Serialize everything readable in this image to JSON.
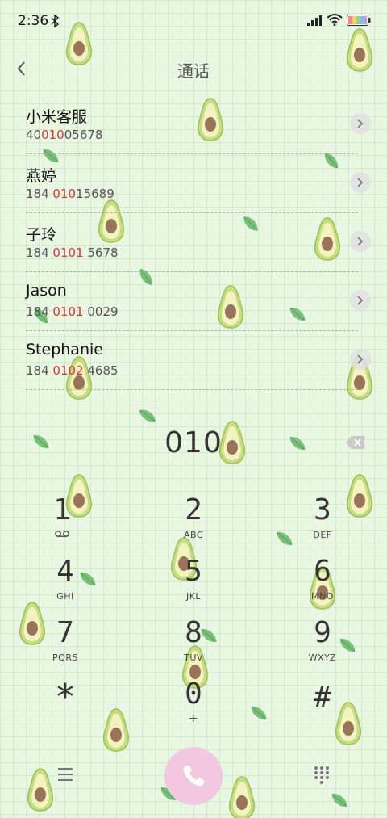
{
  "status_bar": {
    "time": "2:36"
  },
  "header": {
    "title": "通话"
  },
  "contacts": [
    {
      "name": "小米客服",
      "number_pre": "40",
      "number_match": "010",
      "number_post": "05678"
    },
    {
      "name": "燕婷",
      "number_pre": "184 ",
      "number_match": "010",
      "number_post": "15689"
    },
    {
      "name": "子玲",
      "number_pre": "184 ",
      "number_match": "0101",
      "number_post": " 5678"
    },
    {
      "name": "Jason",
      "number_pre": "184 ",
      "number_match": "0101",
      "number_post": " 0029"
    },
    {
      "name": "Stephanie",
      "number_pre": "184 ",
      "number_match": "0102",
      "number_post": " 4685"
    }
  ],
  "dialer": {
    "number": "010",
    "keys": [
      {
        "digit": "1",
        "sub": "voicemail-icon"
      },
      {
        "digit": "2",
        "sub": "ABC"
      },
      {
        "digit": "3",
        "sub": "DEF"
      },
      {
        "digit": "4",
        "sub": "GHI"
      },
      {
        "digit": "5",
        "sub": "JKL"
      },
      {
        "digit": "6",
        "sub": "MNO"
      },
      {
        "digit": "7",
        "sub": "PQRS"
      },
      {
        "digit": "8",
        "sub": "TUV"
      },
      {
        "digit": "9",
        "sub": "WXYZ"
      },
      {
        "digit": "*",
        "sub": ""
      },
      {
        "digit": "0",
        "sub": "+"
      },
      {
        "digit": "#",
        "sub": ""
      }
    ]
  },
  "theme": {
    "background": "#e8f7e2",
    "call_button": "#f1c8e0",
    "match_highlight": "#e0303a"
  },
  "icons": {
    "back": "chevron-left-icon",
    "delete": "backspace-icon",
    "menu": "hamburger-menu-icon",
    "call": "phone-icon",
    "dialpad": "dialpad-icon"
  }
}
